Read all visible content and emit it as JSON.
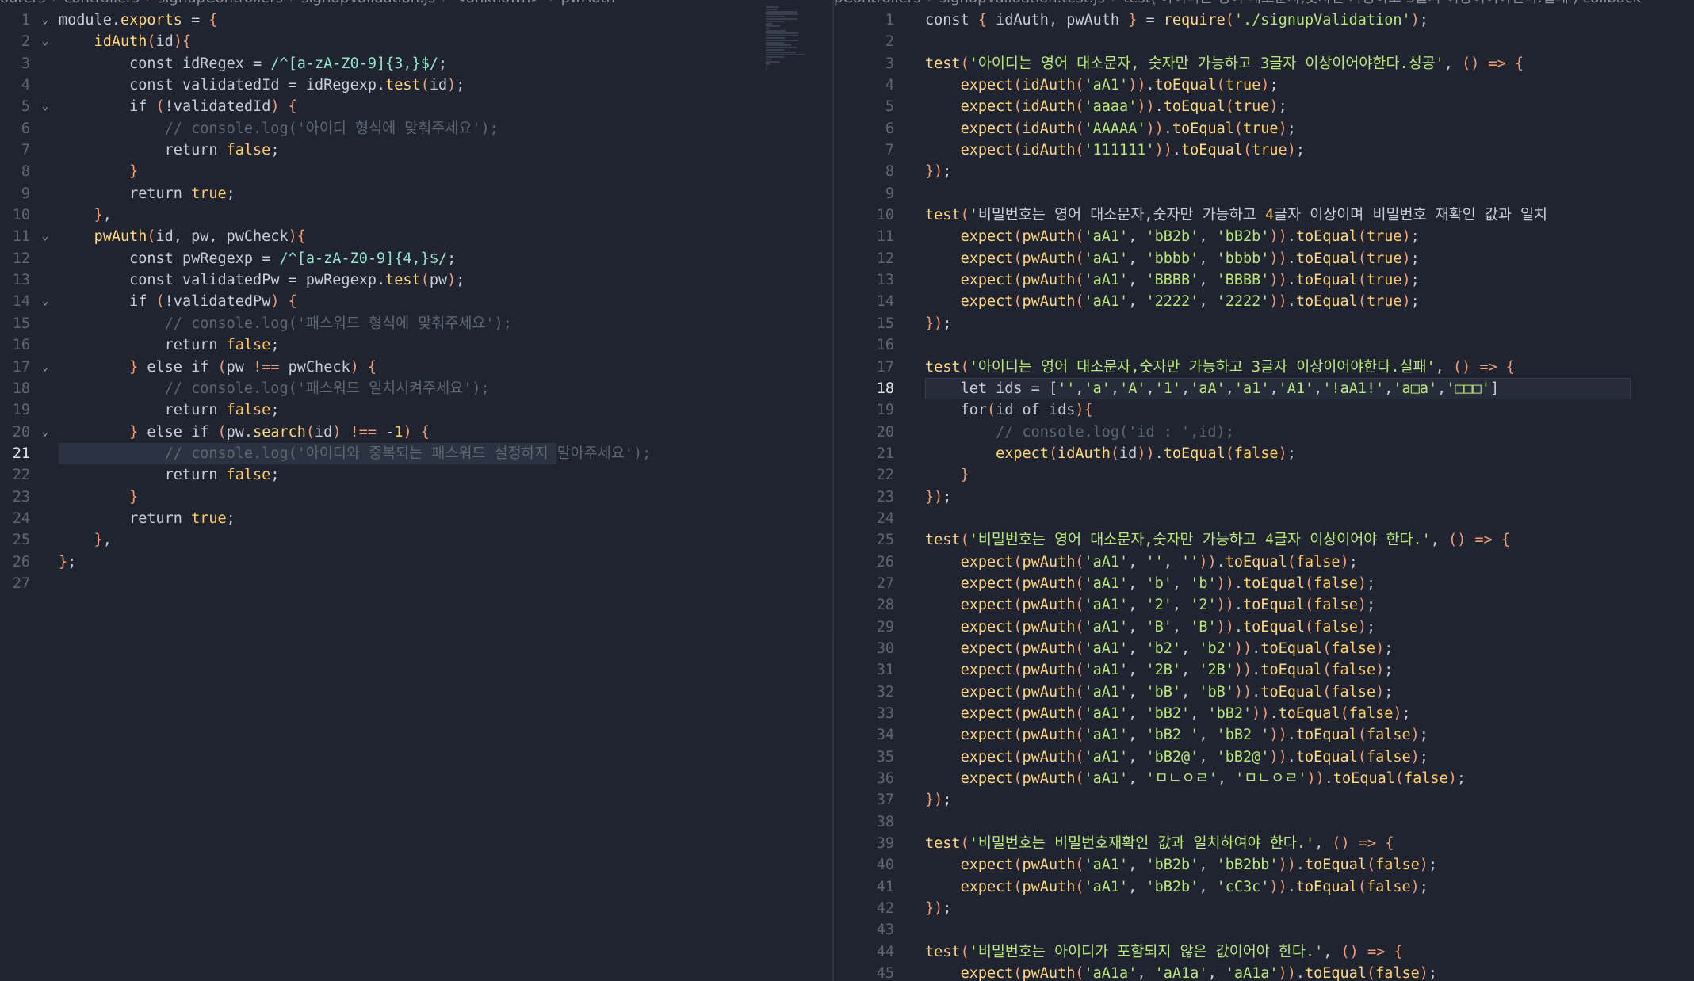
{
  "left": {
    "breadcrumb": [
      "outers",
      "controllers",
      "signupControllers",
      "signupValidation.js",
      "<unknown>",
      "pwAuth"
    ],
    "active_line": 21,
    "lines": [
      "module.exports = {",
      "    idAuth(id){",
      "        const idRegex = /^[a-zA-Z0-9]{3,}$/;",
      "        const validatedId = idRegexp.test(id);",
      "        if (!validatedId) {",
      "            // console.log('아이디 형식에 맞춰주세요');",
      "            return false;",
      "        }",
      "        return true;",
      "    },",
      "    pwAuth(id, pw, pwCheck){",
      "        const pwRegexp = /^[a-zA-Z0-9]{4,}$/;",
      "        const validatedPw = pwRegexp.test(pw);",
      "        if (!validatedPw) {",
      "            // console.log('패스워드 형식에 맞춰주세요');",
      "            return false;",
      "        } else if (pw !== pwCheck) {",
      "            // console.log('패스워드 일치시켜주세요');",
      "            return false;",
      "        } else if (pw.search(id) !== -1) {",
      "            // console.log('아이디와 중복되는 패스워드 설정하지 말아주세요');",
      "            return false;",
      "        }",
      "        return true;",
      "    },",
      "};",
      ""
    ],
    "folds": [
      1,
      2,
      5,
      11,
      14,
      17,
      20
    ]
  },
  "right": {
    "breadcrumb": [
      "pControllers",
      "signupValidation.test.js",
      "test('아이디는 영어 대소문자,숫자만 가능하고 3글자 이상이어야한다.실패') callback"
    ],
    "active_line": 18,
    "lines": [
      "const { idAuth, pwAuth } = require('./signupValidation');",
      "",
      "test('아이디는 영어 대소문자, 숫자만 가능하고 3글자 이상이어야한다.성공', () => {",
      "    expect(idAuth('aA1')).toEqual(true);",
      "    expect(idAuth('aaaa')).toEqual(true);",
      "    expect(idAuth('AAAAA')).toEqual(true);",
      "    expect(idAuth('111111')).toEqual(true);",
      "});",
      "",
      "test('비밀번호는 영어 대소문자,숫자만 가능하고 4글자 이상이며 비밀번호 재확인 값과 일치",
      "    expect(pwAuth('aA1', 'bB2b', 'bB2b')).toEqual(true);",
      "    expect(pwAuth('aA1', 'bbbb', 'bbbb')).toEqual(true);",
      "    expect(pwAuth('aA1', 'BBBB', 'BBBB')).toEqual(true);",
      "    expect(pwAuth('aA1', '2222', '2222')).toEqual(true);",
      "});",
      "",
      "test('아이디는 영어 대소문자,숫자만 가능하고 3글자 이상이어야한다.실패', () => {",
      "    let ids = ['','a','A','1','aA','a1','A1','!aA1!','a□a','□□□']",
      "    for(id of ids){",
      "        // console.log('id : ',id);",
      "        expect(idAuth(id)).toEqual(false);",
      "    }",
      "});",
      "",
      "test('비밀번호는 영어 대소문자,숫자만 가능하고 4글자 이상이어야 한다.', () => {",
      "    expect(pwAuth('aA1', '', '')).toEqual(false);",
      "    expect(pwAuth('aA1', 'b', 'b')).toEqual(false);",
      "    expect(pwAuth('aA1', '2', '2')).toEqual(false);",
      "    expect(pwAuth('aA1', 'B', 'B')).toEqual(false);",
      "    expect(pwAuth('aA1', 'b2', 'b2')).toEqual(false);",
      "    expect(pwAuth('aA1', '2B', '2B')).toEqual(false);",
      "    expect(pwAuth('aA1', 'bB', 'bB')).toEqual(false);",
      "    expect(pwAuth('aA1', 'bB2', 'bB2')).toEqual(false);",
      "    expect(pwAuth('aA1', 'bB2 ', 'bB2 ')).toEqual(false);",
      "    expect(pwAuth('aA1', 'bB2@', 'bB2@')).toEqual(false);",
      "    expect(pwAuth('aA1', 'ㅁㄴㅇㄹ', 'ㅁㄴㅇㄹ')).toEqual(false);",
      "});",
      "",
      "test('비밀번호는 비밀번호재확인 값과 일치하여야 한다.', () => {",
      "    expect(pwAuth('aA1', 'bB2b', 'bB2bb')).toEqual(false);",
      "    expect(pwAuth('aA1', 'bB2b', 'cC3c')).toEqual(false);",
      "});",
      "",
      "test('비밀번호는 아이디가 포함되지 않은 값이어야 한다.', () => {",
      "    expect(pwAuth('aA1a', 'aA1a', 'aA1a')).toEqual(false);"
    ]
  }
}
